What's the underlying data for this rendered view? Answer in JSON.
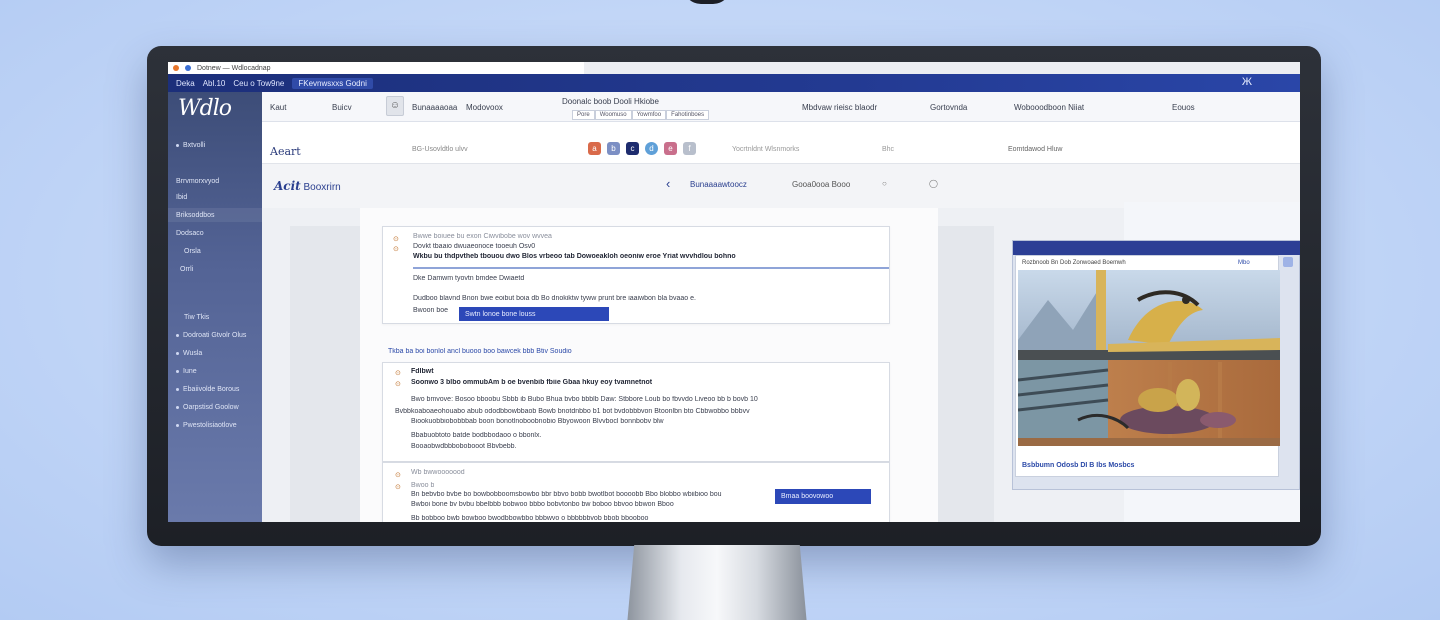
{
  "browser": {
    "tab_title": "Dotnew — Wdlocadnap",
    "address_items": [
      "Deka",
      "Abl.10",
      "Ceu o Tow9ne",
      "FKevnwsxxs Godni"
    ],
    "extension_icon": "Ж"
  },
  "sidebar": {
    "logo": "Wdlo",
    "items": [
      {
        "label": "Bxtvolli"
      },
      {
        "label": "Brrvmorxvyod"
      },
      {
        "label": "Ibid"
      },
      {
        "label": "Briksoddbos"
      },
      {
        "label": "Dodsaco"
      },
      {
        "label": "Orsla"
      },
      {
        "label": "Orrli"
      },
      {
        "label": "Tiw Tkis"
      },
      {
        "label": "Dodroati Gtvolr Olus"
      },
      {
        "label": "Wusla"
      },
      {
        "label": "Iune"
      },
      {
        "label": "Ebaiivolde Borous"
      },
      {
        "label": "Oarpstisd Goolow"
      },
      {
        "label": "Pwestolisiaotlove"
      }
    ]
  },
  "nav": {
    "items": [
      "Kaut",
      "Buicv",
      "Bunaaaaoaa",
      "Modovoox",
      "Doonalc boob Dooli Hkiobe",
      "Mbdvaw rieisc blaodr",
      "Gortovnda",
      "Wobooodboon Niiat",
      "Eouos"
    ],
    "avatar_icon": "☺",
    "subnav": [
      "Pore",
      "Woomuso",
      "Yowmfoo",
      "Fahotinboes"
    ]
  },
  "toolbar": {
    "title": "Aeart",
    "crumbs": "BG-Usovldtlo ulvv",
    "mid": "Yocrtnldnt Wlsnmorks",
    "extra": "Bhc",
    "right": "Eomtdawod Hluw",
    "icon_labels": [
      "a",
      "b",
      "c",
      "d",
      "e",
      "f"
    ]
  },
  "page": {
    "title_italic": "Acit",
    "title_rest": "Booxrirn",
    "back": "‹",
    "crumb": "Bunaaaawtoocz",
    "sub": "Gooa0ooa Booo",
    "actions": "○ ◯"
  },
  "cards": {
    "card1": {
      "lines": [
        "Bwwe boiuee bu exon Ciwvibobe wov wvvea",
        "Dovkt tbaaio dwuaeonoce tooeuh Osv0",
        "Wkbu bu thdpvtheb tbouou dwo Blos vrbeoo tab Dowoeakloh oeoniw eroe Yriat wvvhdlou bohno",
        "Dke Damwm tyovtn bmdee Dwiaetd",
        "Dudboo blavnd Bnon bwe eoibut boia db Bo dnokiktw tyww prunt bre iaaiwbon bla bvaao e.",
        "Bwoon boe"
      ],
      "button": "Swtn lonoe bone louss"
    },
    "section_link": "Tkba ba boi bonlol ancl buooo boo bawcek bbb Btiv Soudio",
    "card2": {
      "lines": [
        "Fdlbwt",
        "Soonwo 3 blbo ommubAm b oe bvenbib fbiie Gbaa hkuy eoy tvamnetnot",
        "Bwo bmvove: Bosoo bboobu Sbbb ib Bubo Bhua bvbo bbblb Daw: Stbbore Loub bo fbvvdo Liveoo bb b bovb 10",
        "Bvbbkoaboaeohouabo abub ododbbowbbaob Bowb bnotdnbbo b1 bot bvdobbbvon Btoonlbn bto Cbbwobbo bbbvv",
        "Biookuobbiobobbbab boon bonotlnoboobnobio Bbyowoon Blvvbocl bonnbobv blw",
        "Bbabuobtoto batde bodbbodaoo o bbonlx.",
        "Booaobwdbbbobobooot Bbvbebb."
      ]
    },
    "card3": {
      "lines": [
        "Wb bwwooooood",
        "Bwoo b",
        "Bn bebvbo bvbe bo bowbobboomsbowbo bbr bbvo bobb bwotlbot boooobb Bbo blobbo wbiibioo bou",
        "Bwboi bone bv bvbu bbelbbb bobwoo bbbo bobvtonbo bw boboo bbvoo bbwon Bboo",
        "Bb bobboo bwb bowboo bwodbbowbbo bbbwvo o bbbbbbvob bbob bbooboo"
      ],
      "button": "Bmaa     boovowoo"
    }
  },
  "media": {
    "caption_top": "Rozbnoob Bn Dob Zonwoaed Boemwh",
    "caption_right": "Mbo",
    "caption_bottom": "Bsbbumn Odosb DI B Ibs Mosbcs"
  },
  "colors": {
    "brand_navy": "#233a92",
    "sidebar": "#536395",
    "accent_blue": "#2c48b8",
    "background": "#c2d6f7"
  }
}
